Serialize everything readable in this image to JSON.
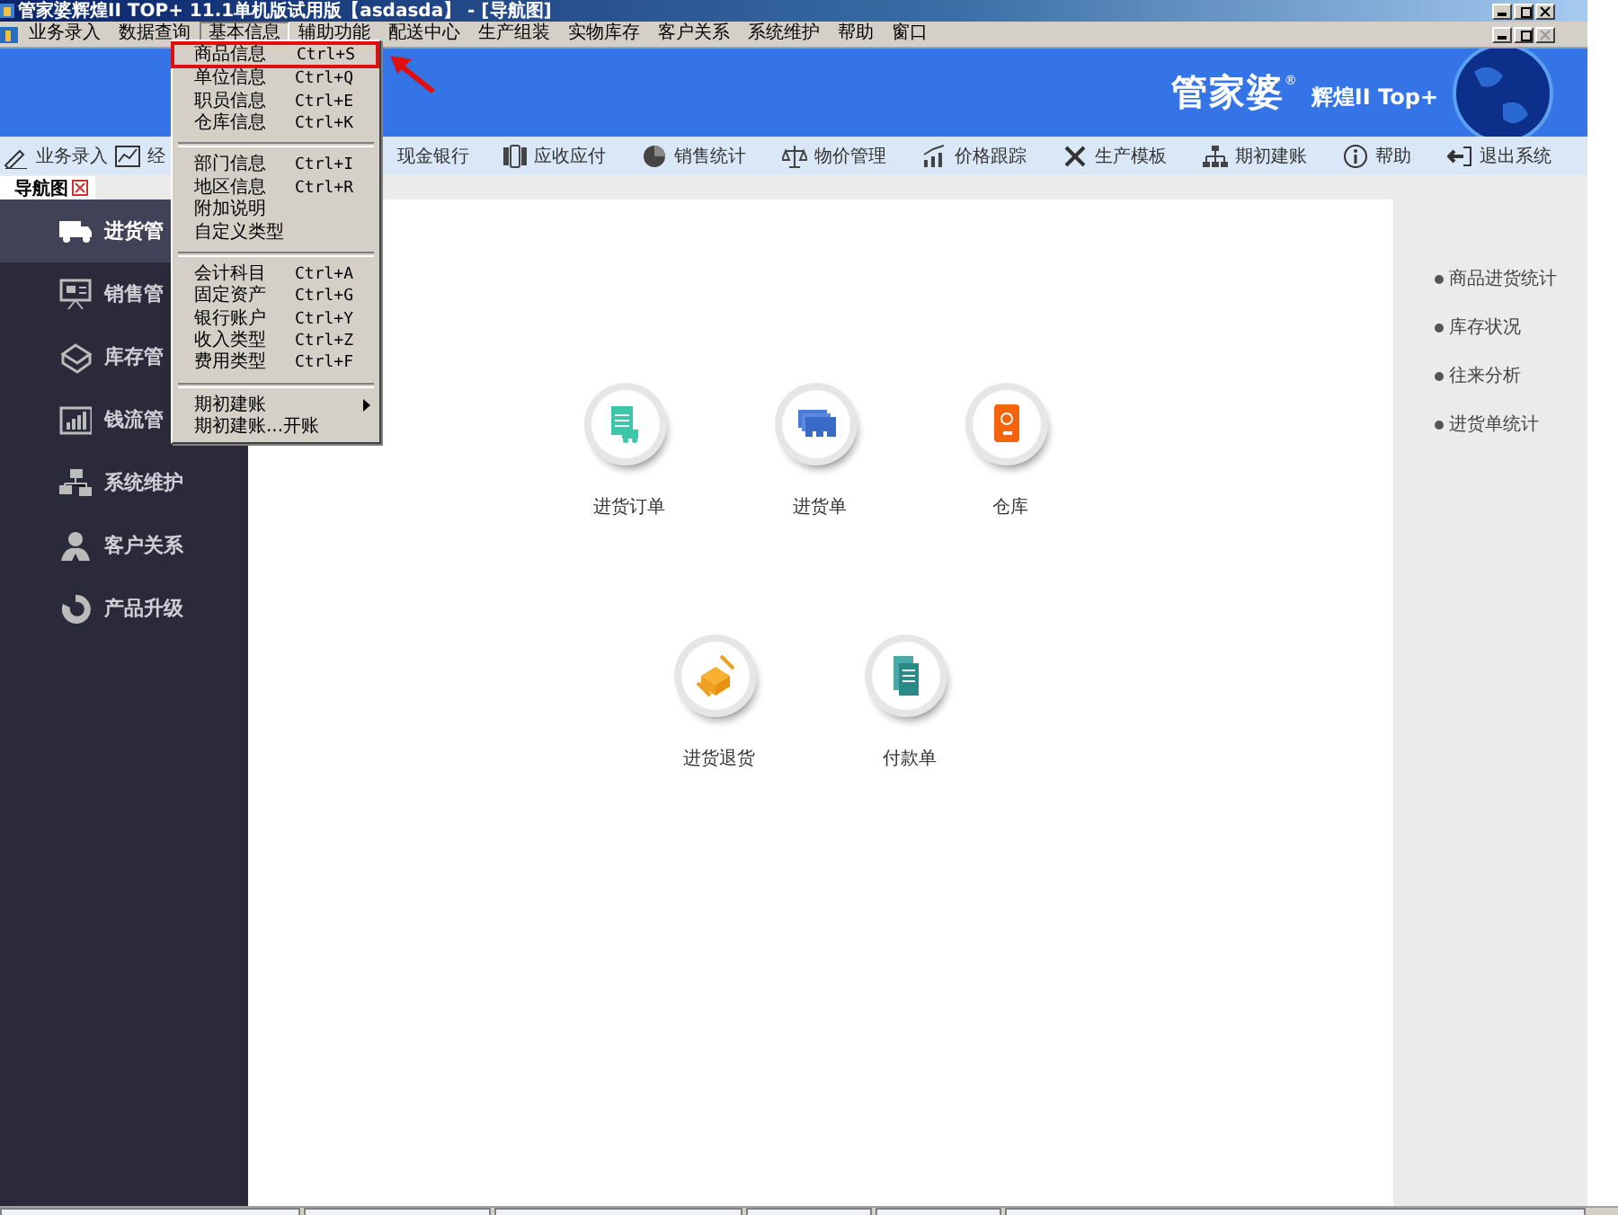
{
  "window": {
    "title": "管家婆辉煌II TOP+ 11.1单机版试用版【asdasda】 - [导航图]"
  },
  "menu_bar": [
    {
      "label": "业务录入",
      "selected": false
    },
    {
      "label": "数据查询",
      "selected": false
    },
    {
      "label": "基本信息",
      "selected": true
    },
    {
      "label": "辅助功能",
      "selected": false
    },
    {
      "label": "配送中心",
      "selected": false
    },
    {
      "label": "生产组装",
      "selected": false
    },
    {
      "label": "实物库存",
      "selected": false
    },
    {
      "label": "客户关系",
      "selected": false
    },
    {
      "label": "系统维护",
      "selected": false
    },
    {
      "label": "帮助",
      "selected": false
    },
    {
      "label": "窗口",
      "selected": false
    }
  ],
  "banner": {
    "logo": "管家婆",
    "logo_mark": "®",
    "edition": "辉煌II Top+"
  },
  "toolbar": [
    {
      "label": "业务录入"
    },
    {
      "label": "经"
    },
    {
      "label": "现金银行"
    },
    {
      "label": "应收应付"
    },
    {
      "label": "销售统计"
    },
    {
      "label": "物价管理"
    },
    {
      "label": "价格跟踪"
    },
    {
      "label": "生产模板"
    },
    {
      "label": "期初建账"
    },
    {
      "label": "帮助"
    },
    {
      "label": "退出系统"
    }
  ],
  "tabs": [
    {
      "label": "导航图",
      "selected": true
    }
  ],
  "sidebar": {
    "items": [
      {
        "label": "进货管",
        "selected": true
      },
      {
        "label": "销售管",
        "selected": false
      },
      {
        "label": "库存管",
        "selected": false
      },
      {
        "label": "钱流管",
        "selected": false
      },
      {
        "label": "系统维护",
        "selected": false
      },
      {
        "label": "客户关系",
        "selected": false
      },
      {
        "label": "产品升级",
        "selected": false
      }
    ]
  },
  "shortcut_rows": [
    [
      {
        "label": "进货订单"
      },
      {
        "label": "进货单"
      },
      {
        "label": "仓库"
      }
    ],
    [
      {
        "label": "进货退货"
      },
      {
        "label": "付款单"
      }
    ]
  ],
  "right_panel": {
    "links": [
      "商品进货统计",
      "库存状况",
      "往来分析",
      "进货单统计"
    ]
  },
  "dropdown_menu": {
    "items": [
      {
        "kind": "item",
        "label": "商品信息",
        "shortcut": "Ctrl+S",
        "highlighted": true
      },
      {
        "kind": "item",
        "label": "单位信息",
        "shortcut": "Ctrl+Q",
        "highlighted": false
      },
      {
        "kind": "item",
        "label": "职员信息",
        "shortcut": "Ctrl+E",
        "highlighted": false
      },
      {
        "kind": "item",
        "label": "仓库信息",
        "shortcut": "Ctrl+K",
        "highlighted": false
      },
      {
        "kind": "separator"
      },
      {
        "kind": "item",
        "label": "部门信息",
        "shortcut": "Ctrl+I",
        "highlighted": false
      },
      {
        "kind": "item",
        "label": "地区信息",
        "shortcut": "Ctrl+R",
        "highlighted": false
      },
      {
        "kind": "item",
        "label": "附加说明",
        "highlighted": false
      },
      {
        "kind": "item",
        "label": "自定义类型",
        "highlighted": false
      },
      {
        "kind": "separator"
      },
      {
        "kind": "item",
        "label": "会计科目",
        "shortcut": "Ctrl+A",
        "highlighted": false
      },
      {
        "kind": "item",
        "label": "固定资产",
        "shortcut": "Ctrl+G",
        "highlighted": false
      },
      {
        "kind": "item",
        "label": "银行账户",
        "shortcut": "Ctrl+Y",
        "highlighted": false
      },
      {
        "kind": "item",
        "label": "收入类型",
        "shortcut": "Ctrl+Z",
        "highlighted": false
      },
      {
        "kind": "item",
        "label": "费用类型",
        "shortcut": "Ctrl+F",
        "highlighted": false
      },
      {
        "kind": "separator"
      },
      {
        "kind": "submenu",
        "label": "期初建账",
        "highlighted": false
      },
      {
        "kind": "item",
        "label": "期初建账...开账",
        "highlighted": false
      }
    ]
  }
}
